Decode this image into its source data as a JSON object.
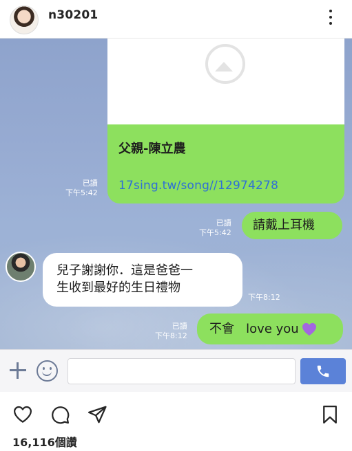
{
  "post": {
    "username": "n30201",
    "likes": "16,116個讚"
  },
  "chat": {
    "link_card": {
      "title": "父親-陳立農",
      "link": "17sing.tw/song//12974278",
      "read": "已讀",
      "time": "下午5:42"
    },
    "messages": [
      {
        "side": "out",
        "text": "請戴上耳機",
        "read": "已讀",
        "time": "下午5:42"
      },
      {
        "side": "in",
        "line1": "兒子謝謝你．這是爸爸一",
        "line2": "生收到最好的生日禮物",
        "time": "下午8:12"
      },
      {
        "side": "out",
        "text": "不會   love you",
        "read": "已讀",
        "time": "下午8:12"
      }
    ],
    "input": {
      "value": "",
      "placeholder": ""
    }
  },
  "icons": {
    "more": "more-options-icon",
    "plus": "plus-icon",
    "emoji": "smile-icon",
    "call": "phone-icon",
    "like": "heart-icon",
    "comment": "comment-icon",
    "share": "send-icon",
    "save": "bookmark-icon",
    "heart_emoji": "purple-heart-icon"
  },
  "colors": {
    "out_bubble": "#8de05e",
    "in_bubble": "#ffffff",
    "link": "#2e6fd6",
    "call_button": "#5b82d8",
    "heart": "#a366e0"
  }
}
